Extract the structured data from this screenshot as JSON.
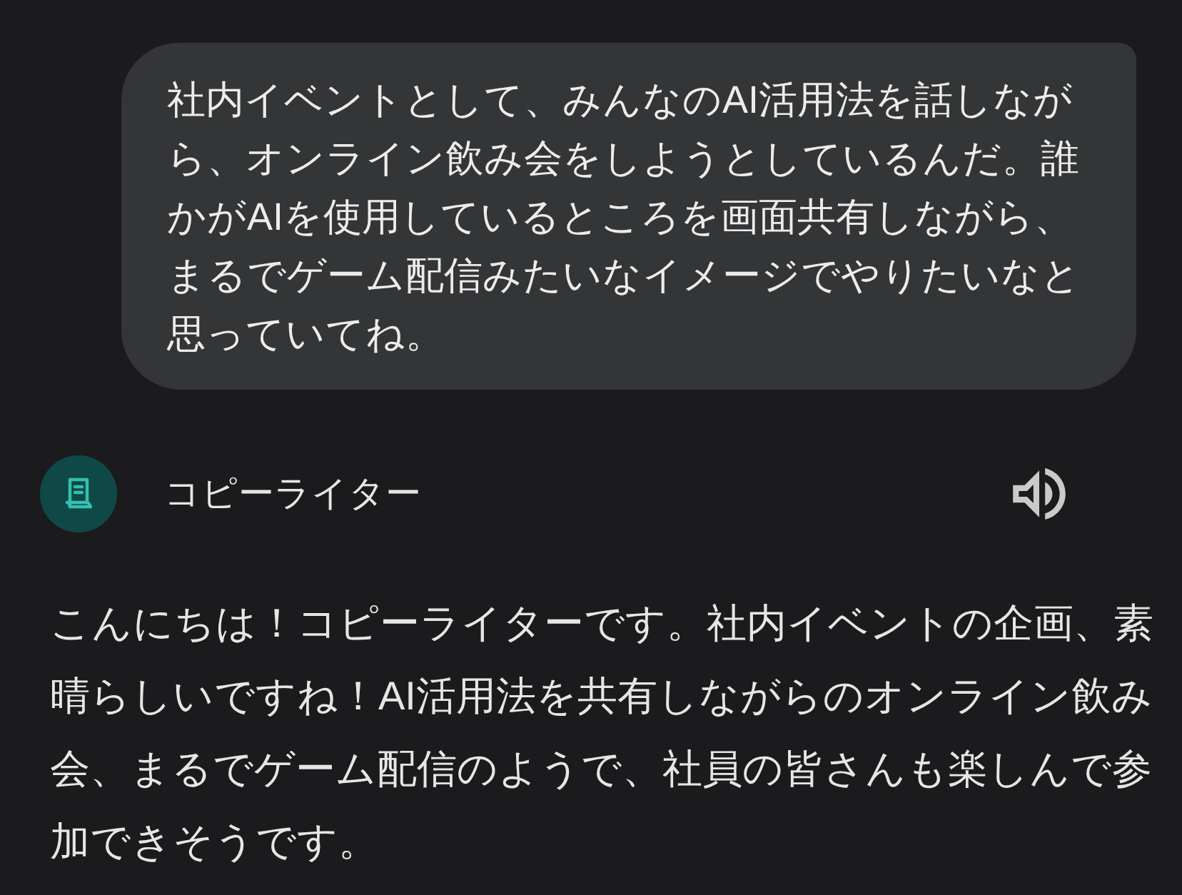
{
  "user_message": {
    "text": "社内イベントとして、みんなのAI活用法を話しながら、オンライン飲み会をしようとしているんだ。誰かがAIを使用しているところを画面共有しながら、まるでゲーム配信みたいなイメージでやりたいなと思っていてね。"
  },
  "assistant": {
    "name": "コピーライター",
    "reply": "こんにちは！コピーライターです。社内イベントの企画、素晴らしいですね！AI活用法を共有しながらのオンライン飲み会、まるでゲーム配信のようで、社員の皆さんも楽しんで参加できそうです。"
  }
}
